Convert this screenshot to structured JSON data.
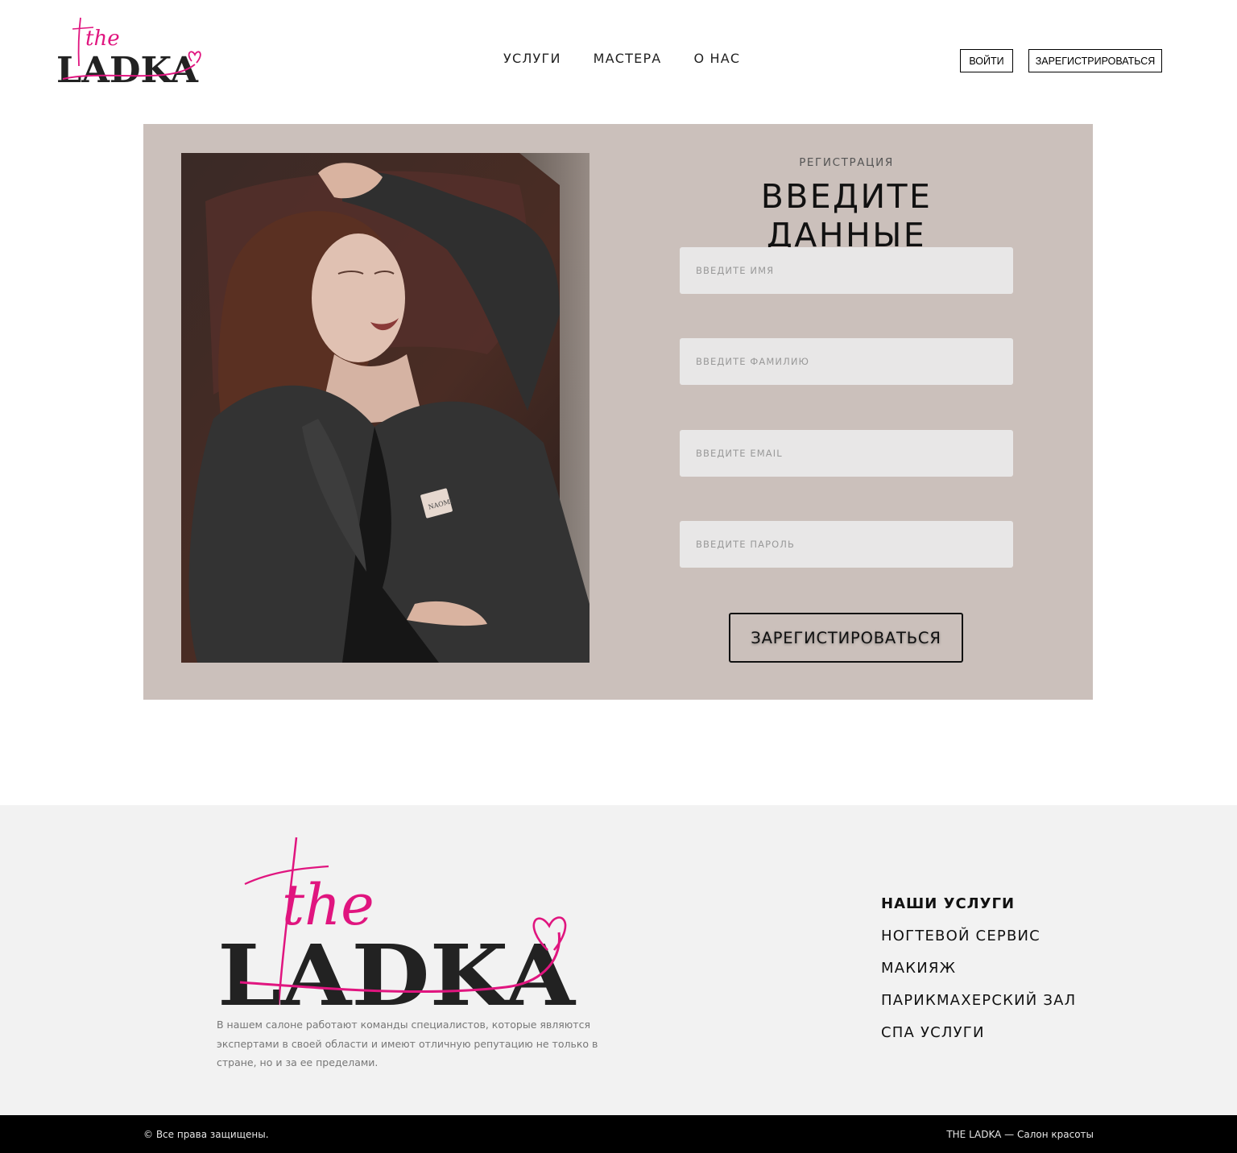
{
  "brand": {
    "logo_script": "the",
    "logo_word": "LADKA",
    "accent_color": "#e0157f"
  },
  "header": {
    "nav": [
      "УСЛУГИ",
      "МАСТЕРА",
      "О НАС"
    ],
    "login_label": "ВОЙТИ",
    "register_label": "ЗАРЕГИСТРИРОВАТЬСЯ"
  },
  "registration": {
    "kicker": "РЕГИСТРАЦИЯ",
    "heading": "ВВЕДИТЕ ДАННЫЕ",
    "fields": [
      {
        "placeholder": "ВВЕДИТЕ ИМЯ",
        "value": ""
      },
      {
        "placeholder": "ВВЕДИТЕ ФАМИЛИЮ",
        "value": ""
      },
      {
        "placeholder": "ВВЕДИТЕ EMAIL",
        "value": ""
      },
      {
        "placeholder": "ВВЕДИТЕ ПАРОЛЬ",
        "value": ""
      }
    ],
    "submit_label": "ЗАРЕГИСТИРОВАТЬСЯ",
    "photo_label": "NAOMI"
  },
  "footer": {
    "about": "В нашем салоне работают команды специалистов, которые являются экспертами в своей области и имеют отличную репутацию не только в стране, но и за ее пределами.",
    "services_title": "НАШИ УСЛУГИ",
    "services": [
      "НОГТЕВОЙ СЕРВИС",
      "МАКИЯЖ",
      "ПАРИКМАХЕРСКИЙ ЗАЛ",
      "СПА УСЛУГИ"
    ],
    "copyright": "© Все права защищены.",
    "tagline": "THE LADKA — Салон красоты"
  },
  "colors": {
    "panel_bg": "#cbc0bb",
    "footer_bg": "#f2f2f2",
    "bottom_bar": "#000000"
  }
}
